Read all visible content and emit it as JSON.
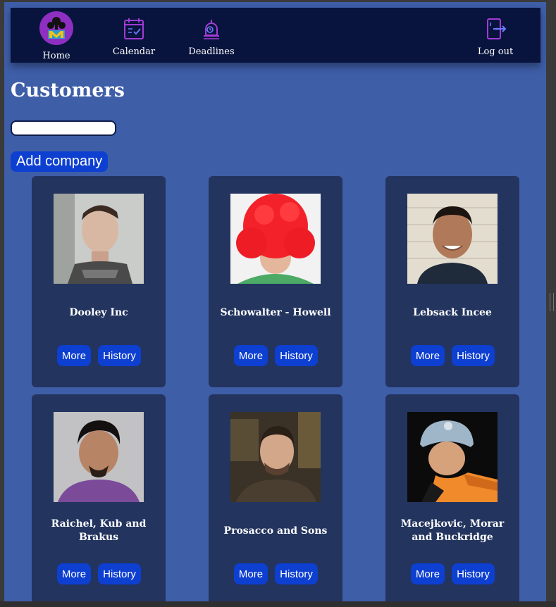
{
  "nav": {
    "home_label": "Home",
    "calendar_label": "Calendar",
    "deadlines_label": "Deadlines",
    "logout_label": "Log out"
  },
  "page": {
    "title": "Customers",
    "search_value": "",
    "add_label": "Add company"
  },
  "customers": [
    {
      "name": "Dooley Inc",
      "more": "More",
      "history": "History"
    },
    {
      "name": "Schowalter - Howell",
      "more": "More",
      "history": "History"
    },
    {
      "name": "Lebsack Incee",
      "more": "More",
      "history": "History"
    },
    {
      "name": "Raichel, Kub and Brakus",
      "more": "More",
      "history": "History"
    },
    {
      "name": "Prosacco and Sons",
      "more": "More",
      "history": "History"
    },
    {
      "name": "Macejkovic, Morar and Buckridge",
      "more": "More",
      "history": "History"
    }
  ],
  "colors": {
    "page_bg": "#3f5ea8",
    "navbar_bg": "#08143d",
    "card_bg": "#23345f",
    "button_bg": "#0d3fd1",
    "icon_accent": "#a23bd6"
  }
}
